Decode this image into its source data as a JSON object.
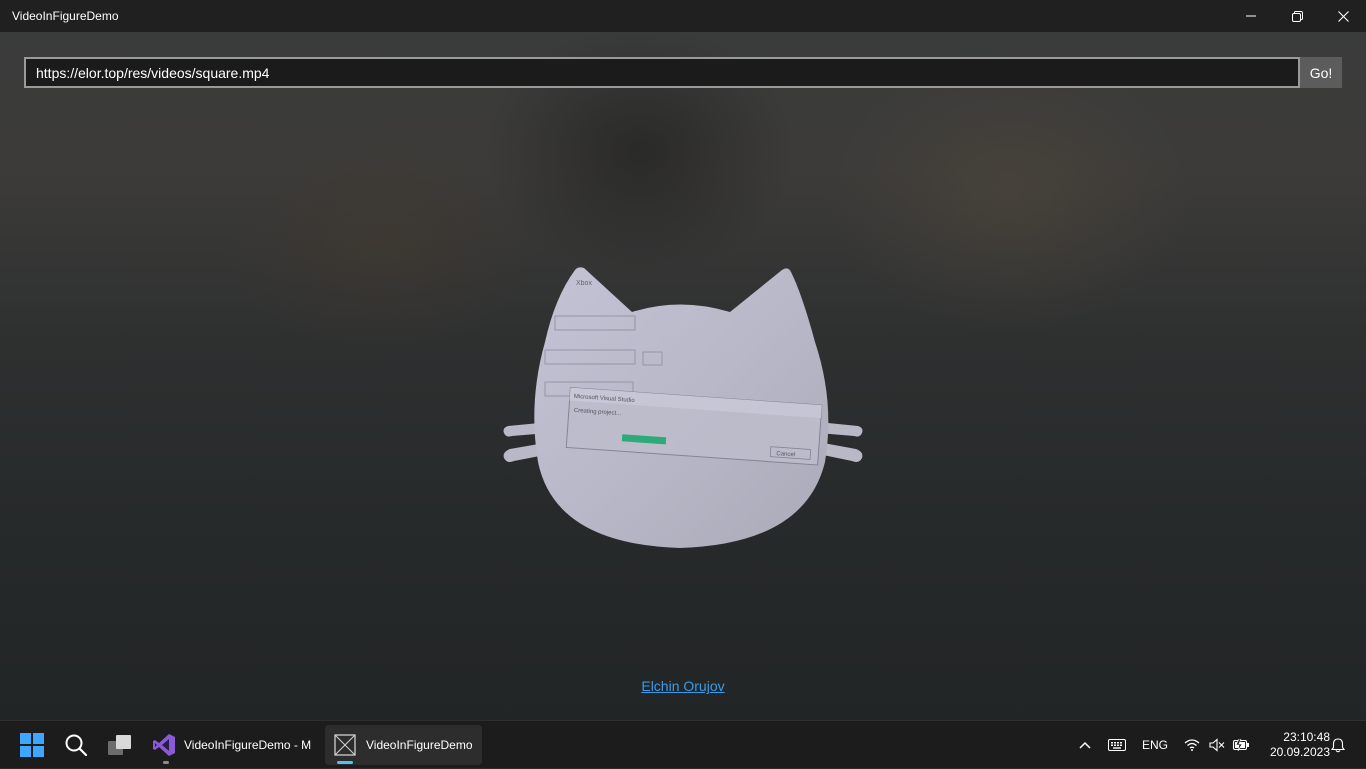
{
  "window": {
    "title": "VideoInFigureDemo",
    "controls": [
      "minimize-icon",
      "restore-icon",
      "close-icon"
    ]
  },
  "urlbar": {
    "value": "https://elor.top/res/videos/square.mp4",
    "go_label": "Go!"
  },
  "video_overlay": {
    "corner_label": "Xbox",
    "dialog_title": "Microsoft Visual Studio",
    "dialog_text": "Creating project...",
    "cancel_label": "Cancel"
  },
  "author_link": "Elchin Orujov",
  "taskbar": {
    "apps": [
      {
        "label": "VideoInFigureDemo - M",
        "icon": "visual-studio-icon",
        "active": false
      },
      {
        "label": "VideoInFigureDemo",
        "icon": "app-window-icon",
        "active": true
      }
    ],
    "tray": {
      "language": "ENG",
      "time": "23:10:48",
      "date": "20.09.2023"
    }
  },
  "colors": {
    "titlebar_bg": "#202020",
    "taskbar_bg": "#1c1c1c",
    "link": "#3b9be8",
    "active_indicator": "#4cc2ff",
    "progress_green": "#15a86b"
  }
}
